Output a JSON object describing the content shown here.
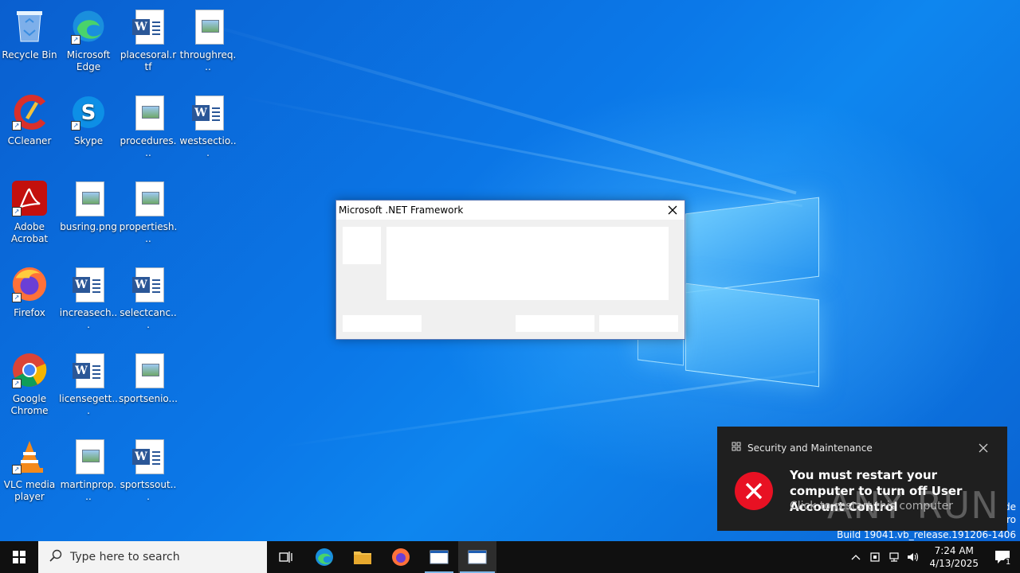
{
  "desktop_icons": [
    {
      "label": "Recycle Bin",
      "icon": "recycle-bin-icon"
    },
    {
      "label": "Microsoft Edge",
      "icon": "edge-icon"
    },
    {
      "label": "placesoral.rtf",
      "icon": "word-document-icon"
    },
    {
      "label": "throughreq...",
      "icon": "image-file-icon"
    },
    {
      "label": "CCleaner",
      "icon": "ccleaner-icon"
    },
    {
      "label": "Skype",
      "icon": "skype-icon"
    },
    {
      "label": "procedures...",
      "icon": "image-file-icon"
    },
    {
      "label": "westsectio...",
      "icon": "word-document-icon"
    },
    {
      "label": "Adobe Acrobat",
      "icon": "adobe-acrobat-icon"
    },
    {
      "label": "busring.png",
      "icon": "image-file-icon"
    },
    {
      "label": "propertiesh...",
      "icon": "image-file-icon"
    },
    {
      "label": "Firefox",
      "icon": "firefox-icon"
    },
    {
      "label": "increasech...",
      "icon": "word-document-icon"
    },
    {
      "label": "selectcanc...",
      "icon": "word-document-icon"
    },
    {
      "label": "Google Chrome",
      "icon": "chrome-icon"
    },
    {
      "label": "licensegett...",
      "icon": "word-document-icon"
    },
    {
      "label": "sportsenio...",
      "icon": "image-file-icon"
    },
    {
      "label": "VLC media player",
      "icon": "vlc-icon"
    },
    {
      "label": "martinprop...",
      "icon": "image-file-icon"
    },
    {
      "label": "sportssout...",
      "icon": "word-document-icon"
    }
  ],
  "dialog": {
    "title": "Microsoft .NET Framework",
    "close_icon": "close-icon"
  },
  "toast": {
    "app_name": "Security and Maintenance",
    "message": "You must restart your computer to turn off User Account Control",
    "subtext": "Click to restart this computer",
    "error_color": "#e81123"
  },
  "watermark": "ANY RUN",
  "desktop_text": {
    "edge_line1": "de",
    "edge_line2": "ro",
    "build": "Build 19041.vb_release.191206-1406"
  },
  "taskbar": {
    "search_placeholder": "Type here to search",
    "pinned": [
      "start-icon",
      "task-view-icon",
      "edge-icon",
      "file-explorer-icon",
      "firefox-icon",
      "window-app-icon",
      "window-app-icon-active"
    ]
  },
  "tray": {
    "time": "7:24 AM",
    "date": "4/13/2025",
    "notification_count": "1"
  }
}
